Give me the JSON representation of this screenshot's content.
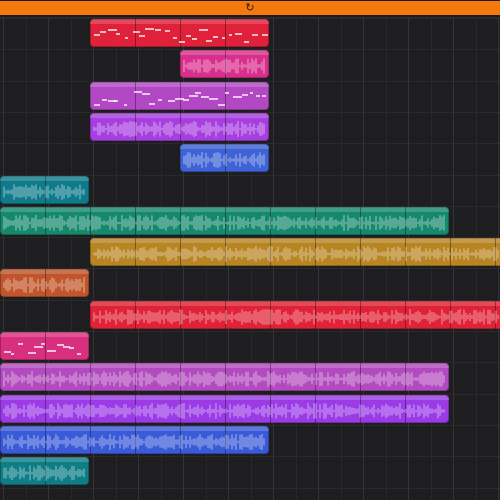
{
  "window": {
    "title": ""
  },
  "ruler": {
    "cycle_color": "#f47a0f",
    "icon": "loop-icon"
  },
  "tracks": [
    {
      "id": "t1",
      "color": "#e1213a",
      "content": "midi",
      "regions": [
        {
          "start": 2,
          "end": 6
        }
      ]
    },
    {
      "id": "t2",
      "color": "#d92f8c",
      "content": "audio",
      "regions": [
        {
          "start": 4,
          "end": 6
        }
      ]
    },
    {
      "id": "t3",
      "color": "#b348c4",
      "content": "midi",
      "regions": [
        {
          "start": 2,
          "end": 6
        }
      ]
    },
    {
      "id": "t4",
      "color": "#a63ee0",
      "content": "audio",
      "regions": [
        {
          "start": 2,
          "end": 6
        }
      ]
    },
    {
      "id": "t5",
      "color": "#3e63d6",
      "content": "audio",
      "regions": [
        {
          "start": 4,
          "end": 6
        }
      ]
    },
    {
      "id": "t6",
      "color": "#0f7b8a",
      "content": "audio",
      "regions": [
        {
          "start": 0,
          "end": 2
        }
      ]
    },
    {
      "id": "t7",
      "color": "#16896c",
      "content": "audio",
      "regions": [
        {
          "start": 0,
          "end": 10
        }
      ]
    },
    {
      "id": "t8",
      "color": "#b88523",
      "content": "audio",
      "regions": [
        {
          "start": 2,
          "end": 11.2
        }
      ]
    },
    {
      "id": "t9",
      "color": "#c0552b",
      "content": "audio",
      "regions": [
        {
          "start": 0,
          "end": 2
        }
      ]
    },
    {
      "id": "t10",
      "color": "#df2236",
      "content": "audio",
      "regions": [
        {
          "start": 2,
          "end": 11.2
        }
      ]
    },
    {
      "id": "t11",
      "color": "#d8307e",
      "content": "midi",
      "regions": [
        {
          "start": 0,
          "end": 2
        }
      ]
    },
    {
      "id": "t12",
      "color": "#b24bbf",
      "content": "audio",
      "regions": [
        {
          "start": 0,
          "end": 10
        }
      ]
    },
    {
      "id": "t13",
      "color": "#9a3be6",
      "content": "audio",
      "regions": [
        {
          "start": 0,
          "end": 10
        }
      ]
    },
    {
      "id": "t14",
      "color": "#3a5bd8",
      "content": "audio",
      "regions": [
        {
          "start": 0,
          "end": 6
        }
      ]
    },
    {
      "id": "t15",
      "color": "#0f7d86",
      "content": "audio",
      "regions": [
        {
          "start": 0,
          "end": 2
        }
      ]
    }
  ]
}
